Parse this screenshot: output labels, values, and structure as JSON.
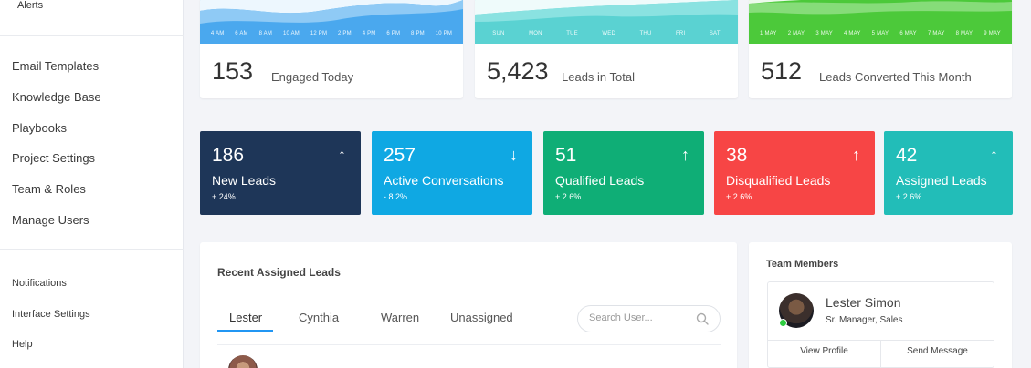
{
  "sidebar": {
    "alerts_label": "Alerts",
    "items": [
      "Email Templates",
      "Knowledge Base",
      "Playbooks",
      "Project Settings",
      "Team & Roles",
      "Manage Users"
    ],
    "footer_items": [
      "Notifications",
      "Interface Settings",
      "Help"
    ]
  },
  "stat_cards": [
    {
      "value": "153",
      "label": "Engaged Today",
      "color": "#4aa8ee",
      "ticks": [
        "4 AM",
        "6 AM",
        "8 AM",
        "10 AM",
        "12 PM",
        "2 PM",
        "4 PM",
        "6 PM",
        "8 PM",
        "10 PM"
      ]
    },
    {
      "value": "5,423",
      "label": "Leads in Total",
      "color": "#5ad2d2",
      "ticks": [
        "SUN",
        "MON",
        "TUE",
        "WED",
        "THU",
        "FRI",
        "SAT"
      ]
    },
    {
      "value": "512",
      "label": "Leads Converted This Month",
      "color": "#4cc93a",
      "ticks": [
        "1 MAY",
        "2 MAY",
        "3 MAY",
        "4 MAY",
        "5 MAY",
        "6 MAY",
        "7 MAY",
        "8 MAY",
        "9 MAY"
      ]
    }
  ],
  "kpis": [
    {
      "value": "186",
      "label": "New Leads",
      "change": "+ 24%",
      "arrow": "↑",
      "color": "#1e3658"
    },
    {
      "value": "257",
      "label": "Active Conversations",
      "change": "- 8.2%",
      "arrow": "↓",
      "color": "#0fa8e3"
    },
    {
      "value": "51",
      "label": "Qualified Leads",
      "change": "+ 2.6%",
      "arrow": "↑",
      "color": "#0fae76"
    },
    {
      "value": "38",
      "label": "Disqualified Leads",
      "change": "+ 2.6%",
      "arrow": "↑",
      "color": "#f74545"
    },
    {
      "value": "42",
      "label": "Assigned Leads",
      "change": "+ 2.6%",
      "arrow": "↑",
      "color": "#22bdb8"
    }
  ],
  "recent": {
    "title": "Recent Assigned Leads",
    "tabs": [
      "Lester",
      "Cynthia",
      "Warren",
      "Unassigned"
    ],
    "active_tab": "Lester",
    "search_placeholder": "Search User..."
  },
  "team": {
    "title": "Team Members",
    "member": {
      "name": "Lester Simon",
      "role": "Sr. Manager, Sales",
      "status": "online"
    },
    "actions": [
      "View Profile",
      "Send Message"
    ]
  }
}
